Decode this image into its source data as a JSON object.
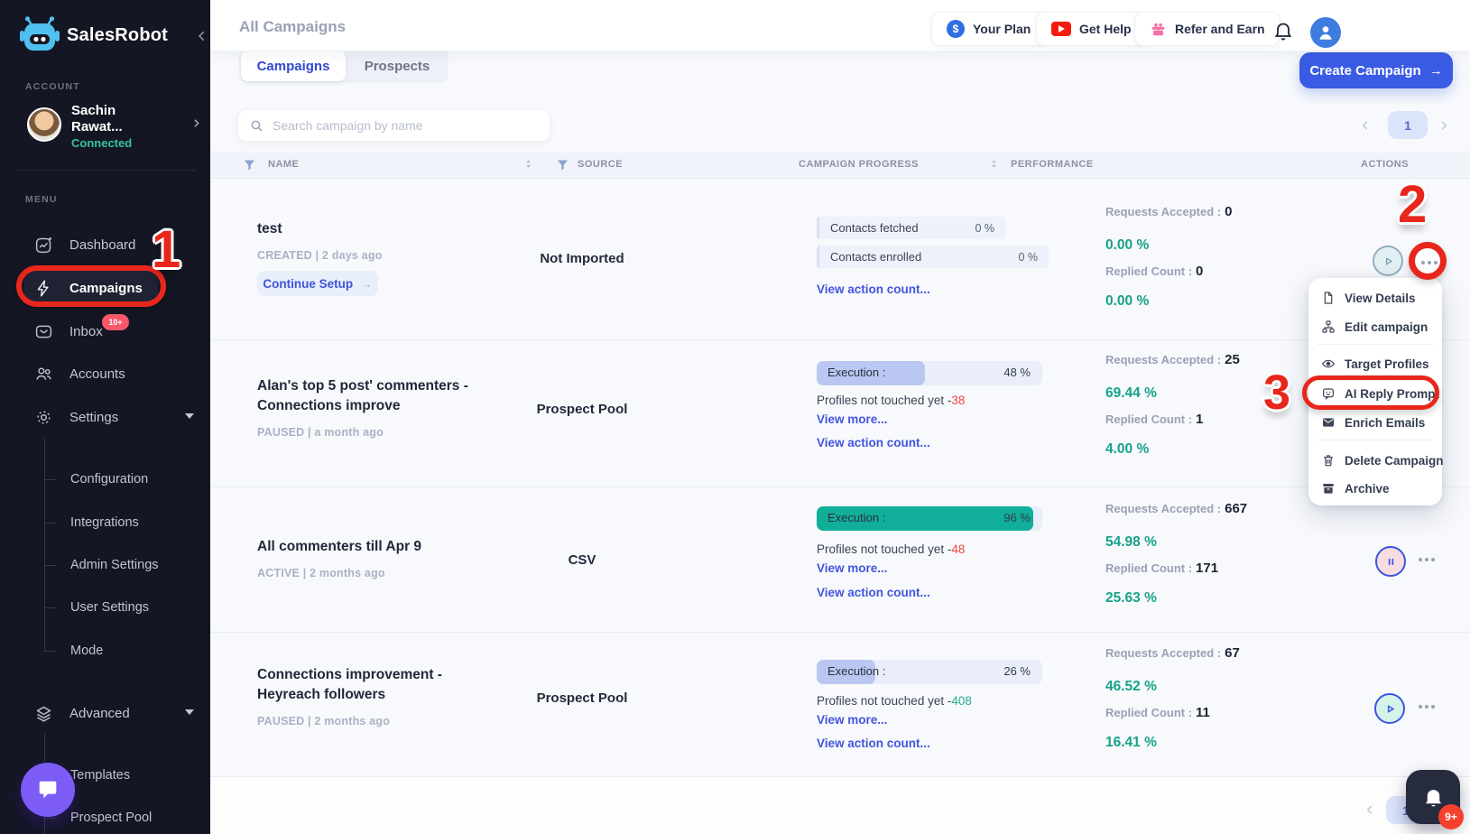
{
  "colors": {
    "accent_blue": "#3a5be4",
    "link_blue": "#4355dd",
    "teal": "#17a28a",
    "annotation_red": "#e8261b",
    "exec_fill_light": "#bac7f1",
    "exec_fill_teal": "#11ae9a",
    "sidebar_bg": "#141623",
    "badge_pink": "#f9586b"
  },
  "sidebar": {
    "brand": "SalesRobot",
    "account_label": "ACCOUNT",
    "account_name": "Sachin Rawat...",
    "account_status": "Connected",
    "menu_label": "MENU",
    "items": {
      "dashboard": "Dashboard",
      "campaigns": "Campaigns",
      "inbox": "Inbox",
      "inbox_badge": "10+",
      "accounts": "Accounts",
      "settings": "Settings",
      "configuration": "Configuration",
      "integrations": "Integrations",
      "admin_settings": "Admin Settings",
      "user_settings": "User Settings",
      "mode": "Mode",
      "advanced": "Advanced",
      "templates": "Templates",
      "prospect_pool": "Prospect Pool"
    }
  },
  "topbar": {
    "title": "All Campaigns",
    "your_plan": "Your Plan",
    "get_help": "Get Help",
    "refer_and_earn": "Refer and Earn",
    "dollar": "$"
  },
  "toolbar": {
    "tab_campaigns": "Campaigns",
    "tab_prospects": "Prospects",
    "create_campaign": "Create Campaign",
    "create_arrow": "→",
    "search_placeholder": "Search campaign by name",
    "page": "1"
  },
  "table": {
    "col_name": "NAME",
    "col_source": "SOURCE",
    "col_progress": "CAMPAIGN PROGRESS",
    "col_performance": "PERFORMANCE",
    "col_actions": "ACTIONS"
  },
  "rows": [
    {
      "name": "test",
      "status": "CREATED | 2 days ago",
      "cta": "Continue Setup",
      "cta_arrow": "→",
      "source": "Not Imported",
      "bar1_label": "Contacts fetched",
      "bar1_pct": "0 %",
      "bar2_label": "Contacts enrolled",
      "bar2_pct": "0 %",
      "action_count_link": "View action count...",
      "accepted_label": "Requests Accepted :",
      "accepted": "0",
      "accepted_pct": "0.00 %",
      "replied_label": "Replied Count :",
      "replied": "0",
      "replied_pct": "0.00 %"
    },
    {
      "name": "Alan's top 5 post' commenters - Connections improve",
      "status": "PAUSED | a month ago",
      "source": "Prospect Pool",
      "exec_label": "Execution :",
      "exec_pct": "48 %",
      "exec_fill": "48%",
      "not_touched_label": "Profiles not touched yet -",
      "not_touched_num": "38",
      "view_more_link": "View more...",
      "action_count_link": "View action count...",
      "accepted_label": "Requests Accepted :",
      "accepted": "25",
      "accepted_pct": "69.44 %",
      "replied_label": "Replied Count :",
      "replied": "1",
      "replied_pct": "4.00 %"
    },
    {
      "name": "All commenters till Apr 9",
      "status": "ACTIVE | 2 months ago",
      "source": "CSV",
      "exec_label": "Execution :",
      "exec_pct": "96 %",
      "exec_fill": "96%",
      "not_touched_label": "Profiles not touched yet -",
      "not_touched_num": "48",
      "view_more_link": "View more...",
      "action_count_link": "View action count...",
      "accepted_label": "Requests Accepted :",
      "accepted": "667",
      "accepted_pct": "54.98 %",
      "replied_label": "Replied Count :",
      "replied": "171",
      "replied_pct": "25.63 %"
    },
    {
      "name": "Connections improvement - Heyreach followers",
      "status": "PAUSED | 2 months ago",
      "source": "Prospect Pool",
      "exec_label": "Execution :",
      "exec_pct": "26 %",
      "exec_fill": "26%",
      "not_touched_label": "Profiles not touched yet -",
      "not_touched_num": "408",
      "view_more_link": "View more...",
      "action_count_link": "View action count...",
      "accepted_label": "Requests Accepted :",
      "accepted": "67",
      "accepted_pct": "46.52 %",
      "replied_label": "Replied Count :",
      "replied": "11",
      "replied_pct": "16.41 %"
    }
  ],
  "context_menu": {
    "view_details": "View Details",
    "edit_campaign": "Edit campaign",
    "target_profiles": "Target Profiles",
    "ai_reply_prompt": "AI Reply Prompt",
    "enrich_emails": "Enrich Emails",
    "delete_campaign": "Delete Campaign",
    "archive": "Archive"
  },
  "annotations": {
    "step1": "1",
    "step2": "2",
    "step3": "3"
  },
  "widgets": {
    "notification_badge": "9+"
  }
}
